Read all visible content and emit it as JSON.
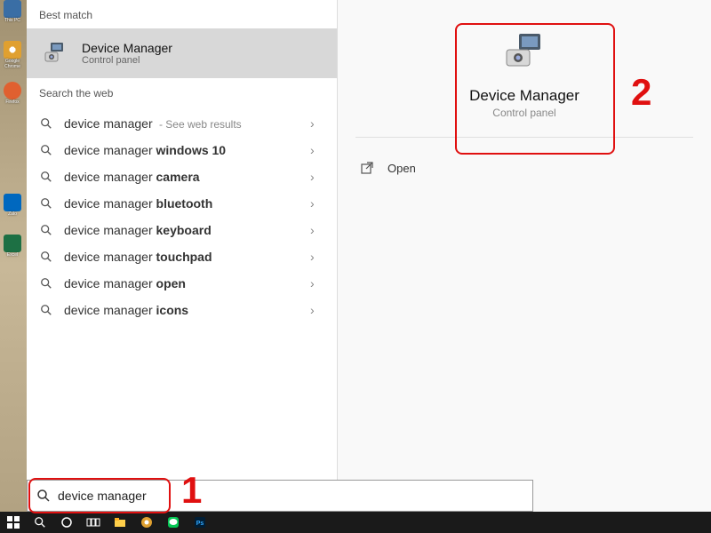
{
  "desktop": {
    "icons": [
      {
        "label": "This PC",
        "color": "#3a6ea5"
      },
      {
        "label": "Google Chrome",
        "color": "#e0a030"
      },
      {
        "label": "Firefox",
        "color": "#e06030"
      },
      {
        "label": "",
        "color": "transparent"
      },
      {
        "label": "Zalo",
        "color": "#0068bf"
      },
      {
        "label": "Excel",
        "color": "#1d7044"
      }
    ]
  },
  "search": {
    "section_best": "Best match",
    "section_web": "Search the web",
    "best_match": {
      "title": "Device Manager",
      "subtitle": "Control panel"
    },
    "suggestions": [
      {
        "prefix": "device manager",
        "bold": "",
        "extra": " - See web results"
      },
      {
        "prefix": "device manager ",
        "bold": "windows 10",
        "extra": ""
      },
      {
        "prefix": "device manager ",
        "bold": "camera",
        "extra": ""
      },
      {
        "prefix": "device manager ",
        "bold": "bluetooth",
        "extra": ""
      },
      {
        "prefix": "device manager ",
        "bold": "keyboard",
        "extra": ""
      },
      {
        "prefix": "device manager ",
        "bold": "touchpad",
        "extra": ""
      },
      {
        "prefix": "device manager ",
        "bold": "open",
        "extra": ""
      },
      {
        "prefix": "device manager ",
        "bold": "icons",
        "extra": ""
      }
    ],
    "input_value": "device manager"
  },
  "detail": {
    "title": "Device Manager",
    "subtitle": "Control panel",
    "actions": [
      {
        "label": "Open"
      }
    ]
  },
  "annotations": {
    "num1": "1",
    "num2": "2"
  }
}
